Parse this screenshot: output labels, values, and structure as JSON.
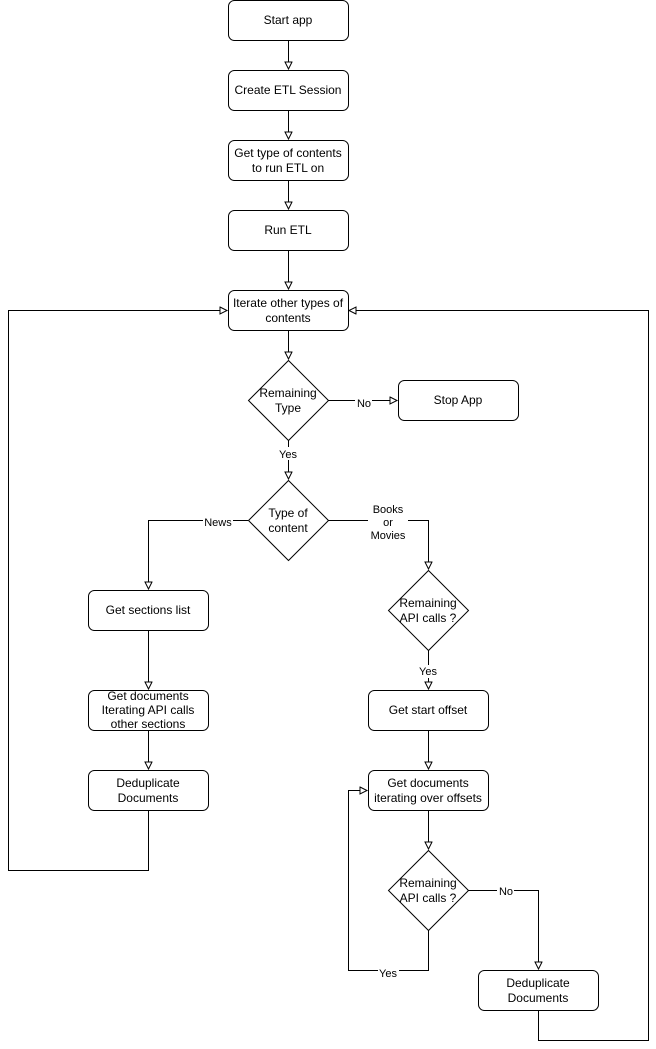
{
  "nodes": {
    "start": [
      "Start app"
    ],
    "create_session": [
      "Create ETL Session"
    ],
    "get_type": [
      "Get type of contents",
      "to run ETL on"
    ],
    "run_etl": [
      "Run ETL"
    ],
    "iterate": [
      "Iterate other types of",
      "contents"
    ],
    "remaining_type": [
      "Remaining",
      "Type"
    ],
    "stop": [
      "Stop App"
    ],
    "type_of_content": [
      "Type of",
      "content"
    ],
    "get_sections": [
      "Get sections list"
    ],
    "get_docs_sections": [
      "Get documents",
      "Iterating API calls",
      "other sections"
    ],
    "dedup_news": [
      "Deduplicate",
      "Documents"
    ],
    "remaining_api_1": [
      "Remaining",
      "API calls ?"
    ],
    "get_start_offset": [
      "Get start offset"
    ],
    "get_docs_offsets": [
      "Get documents",
      "iterating over offsets"
    ],
    "remaining_api_2": [
      "Remaining",
      "API calls ?"
    ],
    "dedup_books": [
      "Deduplicate",
      "Documents"
    ]
  },
  "edge_labels": {
    "no_stop": "No",
    "yes_type": "Yes",
    "news": "News",
    "books_movies": [
      "Books",
      "or",
      "Movies"
    ],
    "yes_api1": "Yes",
    "no_api2": "No",
    "yes_api2": "Yes"
  }
}
